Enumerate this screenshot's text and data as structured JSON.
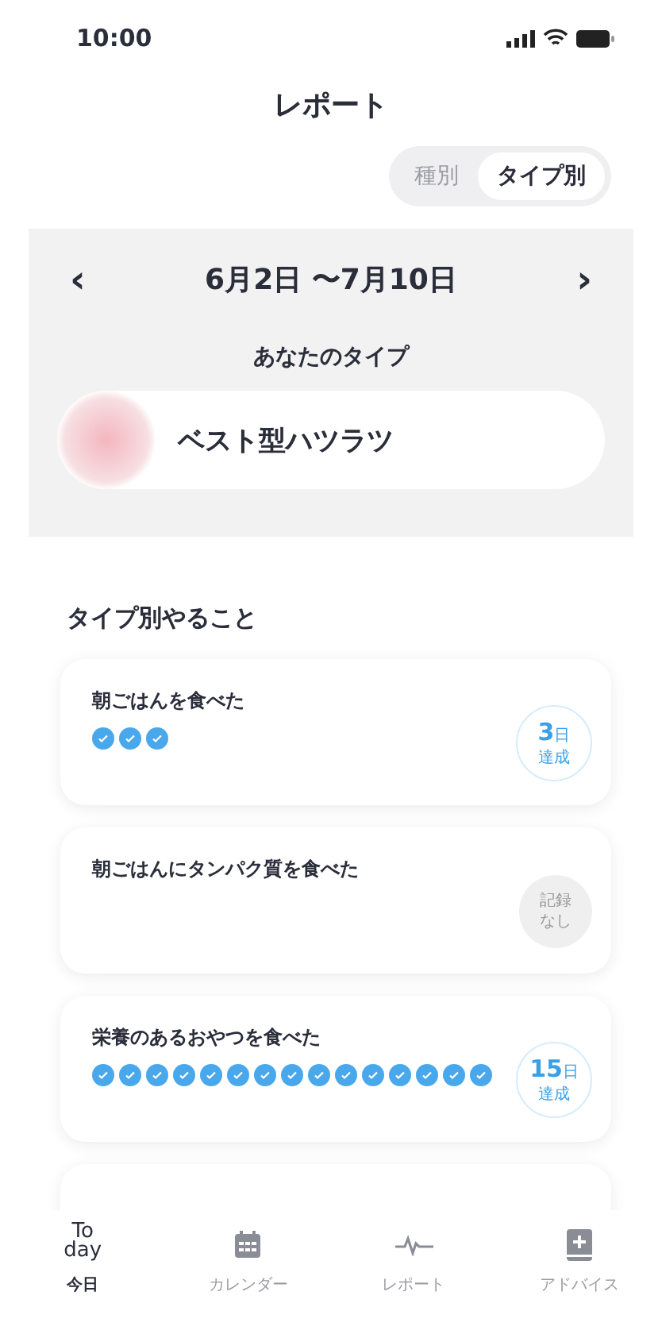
{
  "status_bar": {
    "time": "10:00"
  },
  "header": {
    "title": "レポート"
  },
  "segments": [
    {
      "label": "種別",
      "selected": false
    },
    {
      "label": "タイプ別",
      "selected": true
    }
  ],
  "period": {
    "prev": "‹",
    "range": "6月2日 〜7月10日",
    "next": "›"
  },
  "your_type": {
    "heading": "あなたのタイプ",
    "name": "ベスト型ハツラツ"
  },
  "section": {
    "title": "タイプ別やること"
  },
  "tasks": [
    {
      "title": "朝ごはんを食べた",
      "checks": [
        {
          "checked": true
        },
        {
          "checked": true
        },
        {
          "checked": true
        }
      ],
      "badge": {
        "kind": "achieved",
        "count": "3",
        "unit": "日",
        "label": "達成"
      }
    },
    {
      "title": "朝ごはんにタンパク質を食べた",
      "badge": {
        "kind": "none",
        "lines": [
          "記録",
          "なし"
        ]
      }
    },
    {
      "title": "栄養のあるおやつを食べた",
      "checks": [
        {
          "checked": true
        },
        {
          "checked": true
        },
        {
          "checked": true
        },
        {
          "checked": true
        },
        {
          "checked": true
        },
        {
          "checked": true
        },
        {
          "checked": true
        },
        {
          "checked": true
        },
        {
          "checked": true
        },
        {
          "checked": true
        },
        {
          "checked": true
        },
        {
          "checked": true
        },
        {
          "checked": true
        },
        {
          "checked": true
        },
        {
          "checked": true
        }
      ],
      "badge": {
        "kind": "achieved",
        "count": "15",
        "unit": "日",
        "label": "達成"
      }
    },
    {
      "kind": "cut"
    }
  ],
  "tab_bar": [
    {
      "kind": "today",
      "logo": [
        "To",
        "day"
      ],
      "label": "今日",
      "selected": true
    },
    {
      "kind": "calendar",
      "label": "カレンダー",
      "selected": false
    },
    {
      "kind": "pulse",
      "label": "レポート",
      "selected": false
    },
    {
      "kind": "book",
      "label": "アドバイス",
      "selected": false
    }
  ]
}
